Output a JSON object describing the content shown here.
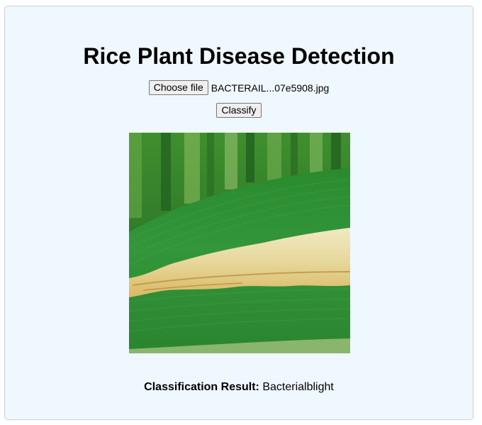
{
  "page": {
    "title": "Rice Plant Disease Detection"
  },
  "upload": {
    "choose_label": "Choose file",
    "file_name": "BACTERAIL...07e5908.jpg",
    "classify_label": "Classify"
  },
  "preview": {
    "alt": "rice-leaf-bacterial-blight-photo"
  },
  "result": {
    "label": "Classification Result:",
    "value": "Bacterialblight"
  },
  "colors": {
    "card_background": "#f0f8ff",
    "card_border": "#c8cfd6",
    "leaf_green": "#2f8c2c",
    "lesion_cream": "#e9dca6"
  }
}
